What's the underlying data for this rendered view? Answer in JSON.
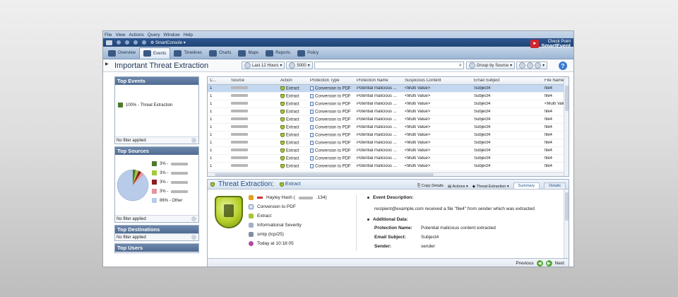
{
  "menu": [
    "File",
    "View",
    "Actions",
    "Query",
    "Window",
    "Help"
  ],
  "quickbar": {
    "console_label": "SmartConsole"
  },
  "brand": {
    "line1": "Check Point",
    "line2": "SmartEvent"
  },
  "ribbon_tabs": [
    {
      "label": "Overview",
      "icon": "gauge-icon"
    },
    {
      "label": "Events",
      "icon": "events-icon",
      "active": true
    },
    {
      "label": "Timelines",
      "icon": "clock-icon"
    },
    {
      "label": "Charts",
      "icon": "bar-chart-icon"
    },
    {
      "label": "Maps",
      "icon": "globe-icon"
    },
    {
      "label": "Reports",
      "icon": "reports-icon"
    },
    {
      "label": "Policy",
      "icon": "policy-icon"
    }
  ],
  "titlebar": {
    "title": "Important Threat Extraction",
    "time_range": "Last 12 Hours",
    "limit": "5000",
    "group_by": "Group by Source",
    "help": "?"
  },
  "sidebar": {
    "top_events": {
      "title": "Top Events",
      "legend": "100% - Threat Extraction",
      "color": "#4c7a2b",
      "footer": "No filter applied"
    },
    "top_sources": {
      "title": "Top Sources",
      "items": [
        {
          "pct": "3% -",
          "color": "#4c7a2b"
        },
        {
          "pct": "3% -",
          "color": "#a4c93a"
        },
        {
          "pct": "3% -",
          "color": "#8a1f1f"
        },
        {
          "pct": "3% -",
          "color": "#e6969c"
        },
        {
          "pct": "86% - Other",
          "color": "#b8cbe8"
        }
      ],
      "footer": "No filter applied"
    },
    "top_destinations": {
      "title": "Top Destinations",
      "footer": "No filter applied"
    },
    "top_users": {
      "title": "Top Users"
    }
  },
  "grid": {
    "columns": [
      "C...",
      "Source",
      "Action",
      "Protection Type",
      "Protection Name",
      "Suspicious Content",
      "Email Subject",
      "File Name"
    ],
    "rows": [
      {
        "count": "1",
        "action": "Extract",
        "ptype": "Conversion to PDF",
        "pname": "Potential malicious ...",
        "susp": "<Multi Value>",
        "subj": "Subject4",
        "file": "file4"
      },
      {
        "count": "1",
        "action": "Extract",
        "ptype": "Conversion to PDF",
        "pname": "Potential malicious ...",
        "susp": "<Multi Value>",
        "subj": "Subject4",
        "file": "file4"
      },
      {
        "count": "1",
        "action": "Extract",
        "ptype": "Conversion to PDF",
        "pname": "Potential malicious ...",
        "susp": "<Multi Value>",
        "subj": "Subject4",
        "file": "<Multi Value>"
      },
      {
        "count": "1",
        "action": "Extract",
        "ptype": "Conversion to PDF",
        "pname": "Potential malicious ...",
        "susp": "<Multi Value>",
        "subj": "Subject4",
        "file": "file4"
      },
      {
        "count": "1",
        "action": "Extract",
        "ptype": "Conversion to PDF",
        "pname": "Potential malicious ...",
        "susp": "<Multi Value>",
        "subj": "Subject4",
        "file": "file4"
      },
      {
        "count": "1",
        "action": "Extract",
        "ptype": "Conversion to PDF",
        "pname": "Potential malicious ...",
        "susp": "<Multi Value>",
        "subj": "Subject4",
        "file": "file4"
      },
      {
        "count": "1",
        "action": "Extract",
        "ptype": "Conversion to PDF",
        "pname": "Potential malicious ...",
        "susp": "<Multi Value>",
        "subj": "Subject4",
        "file": "file4"
      },
      {
        "count": "1",
        "action": "Extract",
        "ptype": "Conversion to PDF",
        "pname": "Potential malicious ...",
        "susp": "<Multi Value>",
        "subj": "Subject4",
        "file": "file4"
      },
      {
        "count": "1",
        "action": "Extract",
        "ptype": "Conversion to PDF",
        "pname": "Potential malicious ...",
        "susp": "<Multi Value>",
        "subj": "Subject4",
        "file": "file4"
      },
      {
        "count": "1",
        "action": "Extract",
        "ptype": "Conversion to PDF",
        "pname": "Potential malicious ...",
        "susp": "<Multi Value>",
        "subj": "Subject4",
        "file": "file4"
      },
      {
        "count": "1",
        "action": "Extract",
        "ptype": "Conversion to PDF",
        "pname": "Potential malicious ...",
        "susp": "<Multi Value>",
        "subj": "Subject4",
        "file": "file4"
      }
    ]
  },
  "detail": {
    "title": "Threat Extraction:",
    "action": "Extract",
    "tools": {
      "copy": "Copy Details",
      "actions": "Actions",
      "te": "Threat Extraction"
    },
    "tabs": [
      "Summary",
      "Details"
    ],
    "props": [
      {
        "text": "Hayley Hash (",
        "suffix": ".134)",
        "icon": "user-icon"
      },
      {
        "text": "Conversion to PDF",
        "icon": "document-icon"
      },
      {
        "text": "Extract",
        "icon": "shield-icon"
      },
      {
        "text": "Informational Severity",
        "icon": "severity-icon"
      },
      {
        "text": "smtp (tcp/25)",
        "icon": "service-icon"
      },
      {
        "text": "Today at 10:18:05",
        "icon": "clock-icon"
      }
    ],
    "event_description_label": "Event Description:",
    "event_description": "recipient@example.com received a file \"file4\" from sender which was extracted",
    "additional_label": "Additional Data:",
    "kv": [
      {
        "k": "Protection Name:",
        "v": "Potential malicious content extracted"
      },
      {
        "k": "Email Subject:",
        "v": "Subject4"
      },
      {
        "k": "Sender:",
        "v": "sender"
      }
    ]
  },
  "nav": {
    "prev": "Previous",
    "next": "Next"
  },
  "colors": {
    "accent": "#1e4f8a",
    "header_blue": "#4f6b93",
    "selected_row": "#c3d7f0"
  }
}
